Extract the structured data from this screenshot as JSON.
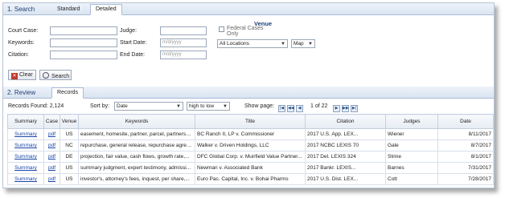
{
  "search": {
    "section_title": "1. Search",
    "tabs": [
      "Standard",
      "Detailed"
    ],
    "court_case_label": "Court Case:",
    "keywords_label": "Keywords:",
    "citation_label": "Citation:",
    "judge_label": "Judge:",
    "start_date_label": "Start Date:",
    "end_date_label": "End Date:",
    "start_date_placeholder": "m/d/yyyy",
    "end_date_placeholder": "m/d/yyyy",
    "venue_heading": "Venue",
    "federal_only_label": "Federal Cases Only",
    "venue_select": "All Locations",
    "map_select": "Map",
    "clear_button": "Clear",
    "search_button": "Search"
  },
  "review": {
    "section_title": "2. Review",
    "tabs": [
      "Records"
    ],
    "records_found": "Records Found: 2,124",
    "sort_by_label": "Sort by:",
    "sort_field": "Date",
    "sort_order": "high to low",
    "show_page_label": "Show page:",
    "page_info": "1 of 22",
    "columns": [
      "Summary",
      "Case",
      "Venue",
      "Keywords",
      "Title",
      "Citation",
      "Judges",
      "Date"
    ],
    "rows": [
      {
        "summary": "Summary",
        "case": "pdf",
        "venue": "US",
        "keywords": "easement, homesite, partner, parcel, partnersh...",
        "title": "BC Ranch II, LP v. Commissioner",
        "citation": "2017 U.S. App. LEX...",
        "judges": "Wiener",
        "date": "8/11/2017"
      },
      {
        "summary": "Summary",
        "case": "pdf",
        "venue": "NC",
        "keywords": "repurchase, general release, repurchase agree...",
        "title": "Walker v. Driven Holdings, LLC",
        "citation": "2017 NCBC LEXIS 70",
        "judges": "Gale",
        "date": "8/7/2017"
      },
      {
        "summary": "Summary",
        "case": "pdf",
        "venue": "DE",
        "keywords": "projection, fair value, cash flows, growth rate,...",
        "title": "DFC Global Corp. v. Muirfield Value Partner...",
        "citation": "2017 Del. LEXIS 324",
        "judges": "Strine",
        "date": "8/1/2017"
      },
      {
        "summary": "Summary",
        "case": "pdf",
        "venue": "US",
        "keywords": "summary judgment, expert testimony, admissi...",
        "title": "Newman v. Associated Bank",
        "citation": "2017 Bankr. LEXIS...",
        "judges": "Barnes",
        "date": "7/31/2017"
      },
      {
        "summary": "Summary",
        "case": "pdf",
        "venue": "US",
        "keywords": "investor's, attorney's fees, inquest, per share,...",
        "title": "Euro Pac. Capital, Inc. v. Bohai Pharms",
        "citation": "2017 U.S. Dist. LEX...",
        "judges": "Cott",
        "date": "7/28/2017"
      }
    ]
  },
  "colors": {
    "header_text": "#1f3e73",
    "link": "#1a46a8",
    "border": "#a9bcd6",
    "clear_icon": "#c0392b"
  },
  "icons": {
    "clear": "red-x-icon",
    "search": "magnifier-icon",
    "pager": [
      "first-page-icon",
      "prev-page-icon",
      "next-page-icon",
      "last-page-icon"
    ]
  }
}
